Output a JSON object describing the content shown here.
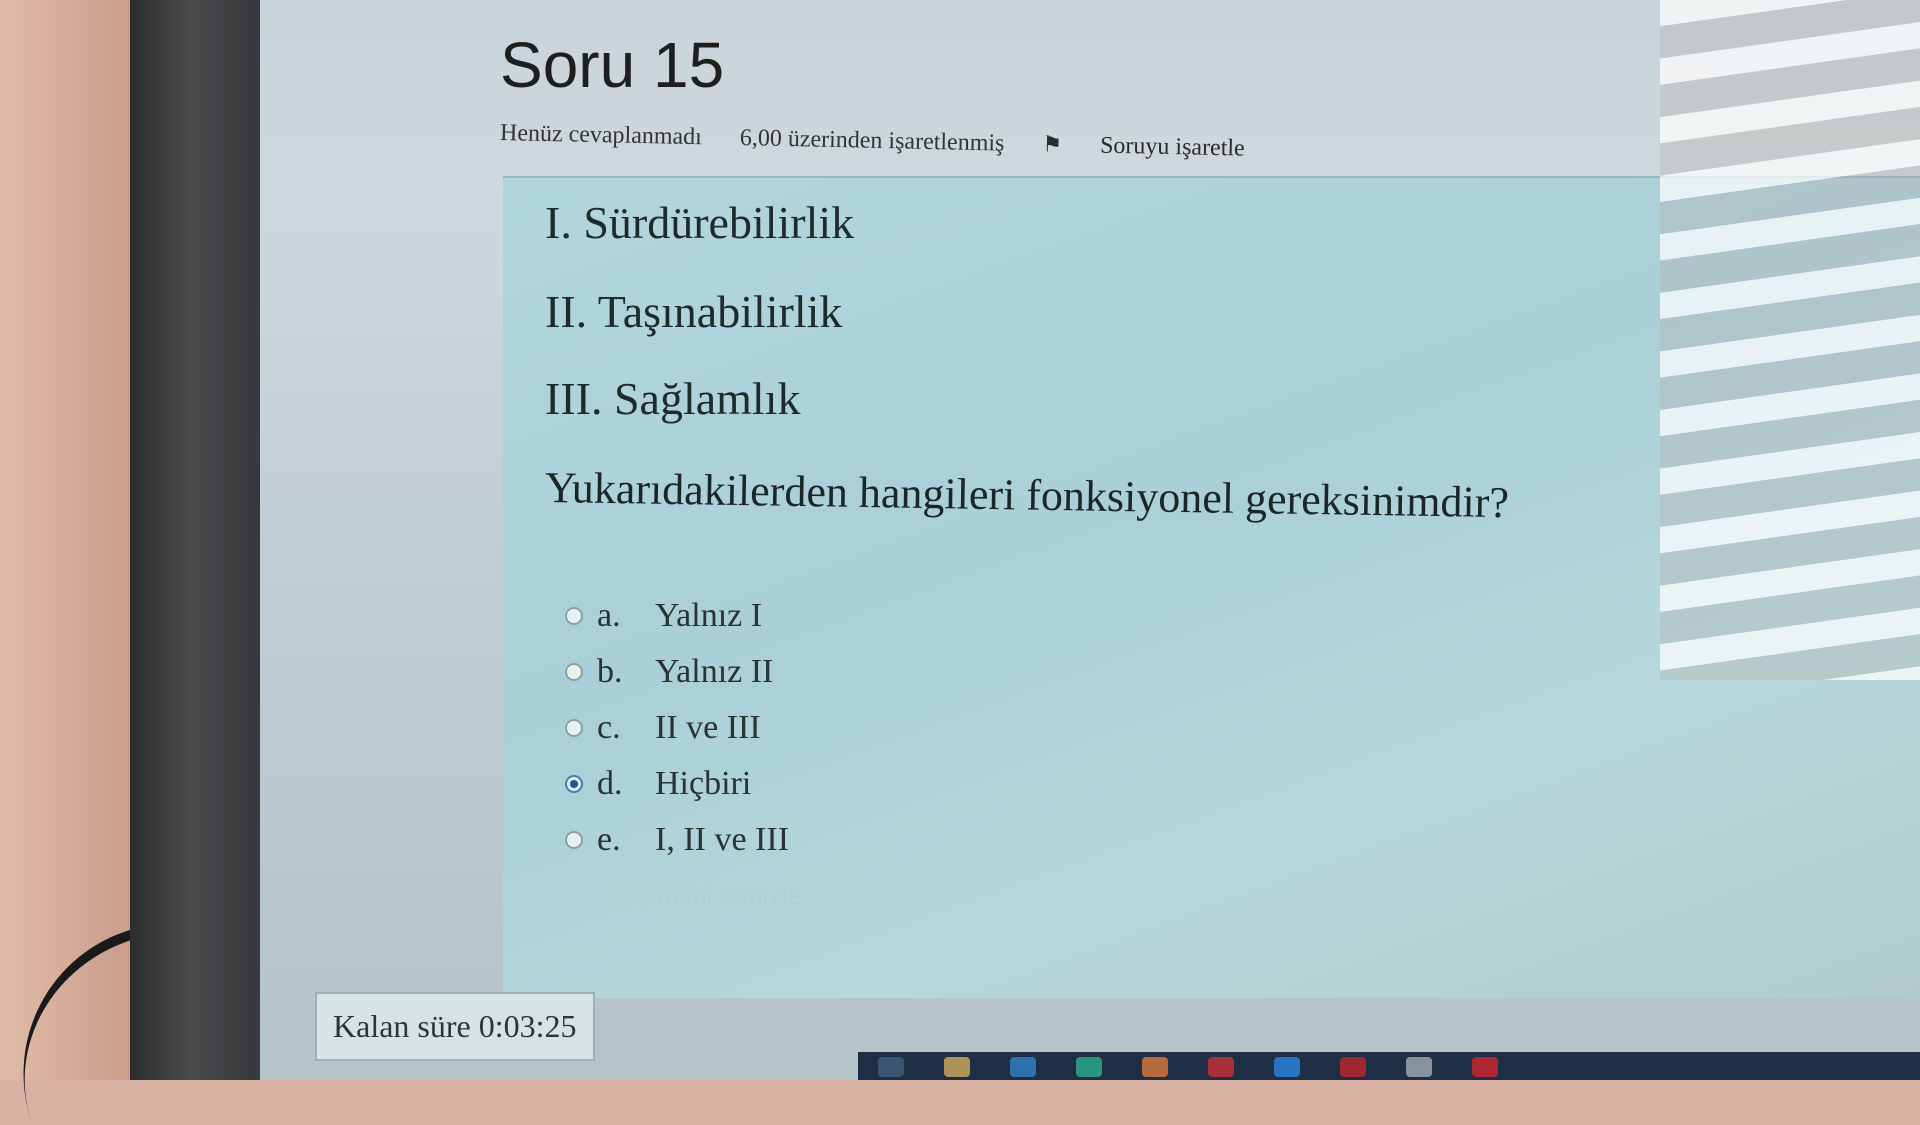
{
  "question": {
    "title": "Soru 15",
    "status": "Henüz cevaplanmadı",
    "marks": "6,00 üzerinden işaretlenmiş",
    "flag_label": "Soruyu işaretle"
  },
  "statements": [
    "I. Sürdürebilirlik",
    "II. Taşınabilirlik",
    "III. Sağlamlık"
  ],
  "prompt": "Yukarıdakilerden hangileri fonksiyonel gereksinimdir?",
  "answers": [
    {
      "letter": "a.",
      "text": "Yalnız I",
      "selected": false
    },
    {
      "letter": "b.",
      "text": "Yalnız II",
      "selected": false
    },
    {
      "letter": "c.",
      "text": "II ve III",
      "selected": false
    },
    {
      "letter": "d.",
      "text": "Hiçbiri",
      "selected": true
    },
    {
      "letter": "e.",
      "text": "I, II ve III",
      "selected": false
    }
  ],
  "clear_choice": "Seçimimi temizle",
  "timer": "Kalan süre 0:03:25",
  "colors": {
    "content_bg": "#aacfd8",
    "selected_radio": "#1e5c8f",
    "taskbar": "#1d2e45"
  },
  "icons": [
    "flag-icon",
    "radio-icon"
  ]
}
